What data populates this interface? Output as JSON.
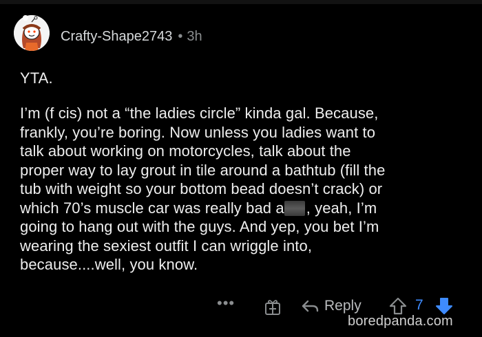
{
  "comment": {
    "username": "Crafty-Shape2743",
    "separator": "•",
    "time": "3h",
    "first_line": "YTA.",
    "lines": [
      "I’m (f cis) not a “the ladies circle” kinda gal. Because,",
      "frankly, you’re boring. Now unless you ladies want to",
      "talk about working on motorcycles, talk about the",
      "proper way to lay grout in tile around a bathtub (fill the",
      "tub with weight so your bottom bead doesn’t crack) or"
    ],
    "censored_line": {
      "before": "which 70’s muscle car was really bad a",
      "after": ", yeah, I’m"
    },
    "lines_after": [
      "going to hang out with the guys. And yep, you bet I’m",
      "wearing the sexiest outfit I can wriggle into,",
      "because....well, you know."
    ]
  },
  "actions": {
    "more_label": "•••",
    "award_icon": "gift-award-icon",
    "reply_icon": "reply-arrow-icon",
    "reply_label": "Reply",
    "upvote_icon": "upvote-arrow-icon",
    "score": "7",
    "downvote_icon": "downvote-arrow-icon"
  },
  "colors": {
    "background": "#000000",
    "text": "#eeeeee",
    "muted": "#8a8d8f",
    "score_blue": "#3e8bff"
  },
  "watermark": "boredpanda.com"
}
